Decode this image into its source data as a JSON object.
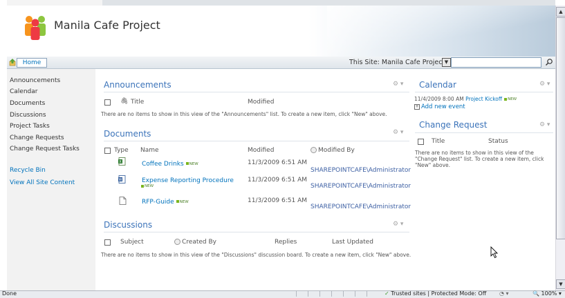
{
  "site": {
    "title": "Manila Cafe Project",
    "home_label": "Home",
    "search_scope": "This Site: Manila Cafe Project",
    "search_value": ""
  },
  "quick_launch": {
    "items": [
      "Announcements",
      "Calendar",
      "Documents",
      "Discussions",
      "Project Tasks",
      "Change Requests",
      "Change Request Tasks"
    ],
    "recycle_bin": "Recycle Bin",
    "view_all": "View All Site Content"
  },
  "announcements": {
    "title": "Announcements",
    "col_title": "Title",
    "col_modified": "Modified",
    "empty": "There are no items to show in this view of the \"Announcements\" list. To create a new item, click \"New\" above."
  },
  "documents": {
    "title": "Documents",
    "col_type": "Type",
    "col_name": "Name",
    "col_modified": "Modified",
    "col_modified_by": "Modified By",
    "rows": [
      {
        "name": "Coffee Drinks",
        "modified": "11/3/2009 6:51 AM",
        "by": "SHAREPOINTCAFE\\Administrator",
        "icon": "excel-icon"
      },
      {
        "name": "Expense Reporting Procedure",
        "modified": "11/3/2009 6:51 AM",
        "by": "SHAREPOINTCAFE\\Administrator",
        "icon": "word-icon"
      },
      {
        "name": "RFP-Guide",
        "modified": "11/3/2009 6:51 AM",
        "by": "SHAREPOINTCAFE\\Administrator",
        "icon": "document-icon"
      }
    ],
    "new_badge": "NEW"
  },
  "discussions": {
    "title": "Discussions",
    "col_subject": "Subject",
    "col_created_by": "Created By",
    "col_replies": "Replies",
    "col_last_updated": "Last Updated",
    "empty": "There are no items to show in this view of the \"Discussions\" discussion board. To create a new item, click \"New\" above."
  },
  "calendar": {
    "title": "Calendar",
    "event_time": "11/4/2009 8:00 AM",
    "event_name": "Project Kickoff",
    "add_new": "Add new event"
  },
  "change_request": {
    "title": "Change Request",
    "col_title": "Title",
    "col_status": "Status",
    "empty": "There are no items to show in this view of the \"Change Request\" list. To create a new item, click \"New\" above."
  },
  "status_bar": {
    "status": "Done",
    "zone": "Trusted sites | Protected Mode: Off",
    "zoom": "100%"
  },
  "colors": {
    "link": "#0072bc",
    "web_part_title": "#3b73b9",
    "quick_launch_bg": "#f2f2f2"
  }
}
